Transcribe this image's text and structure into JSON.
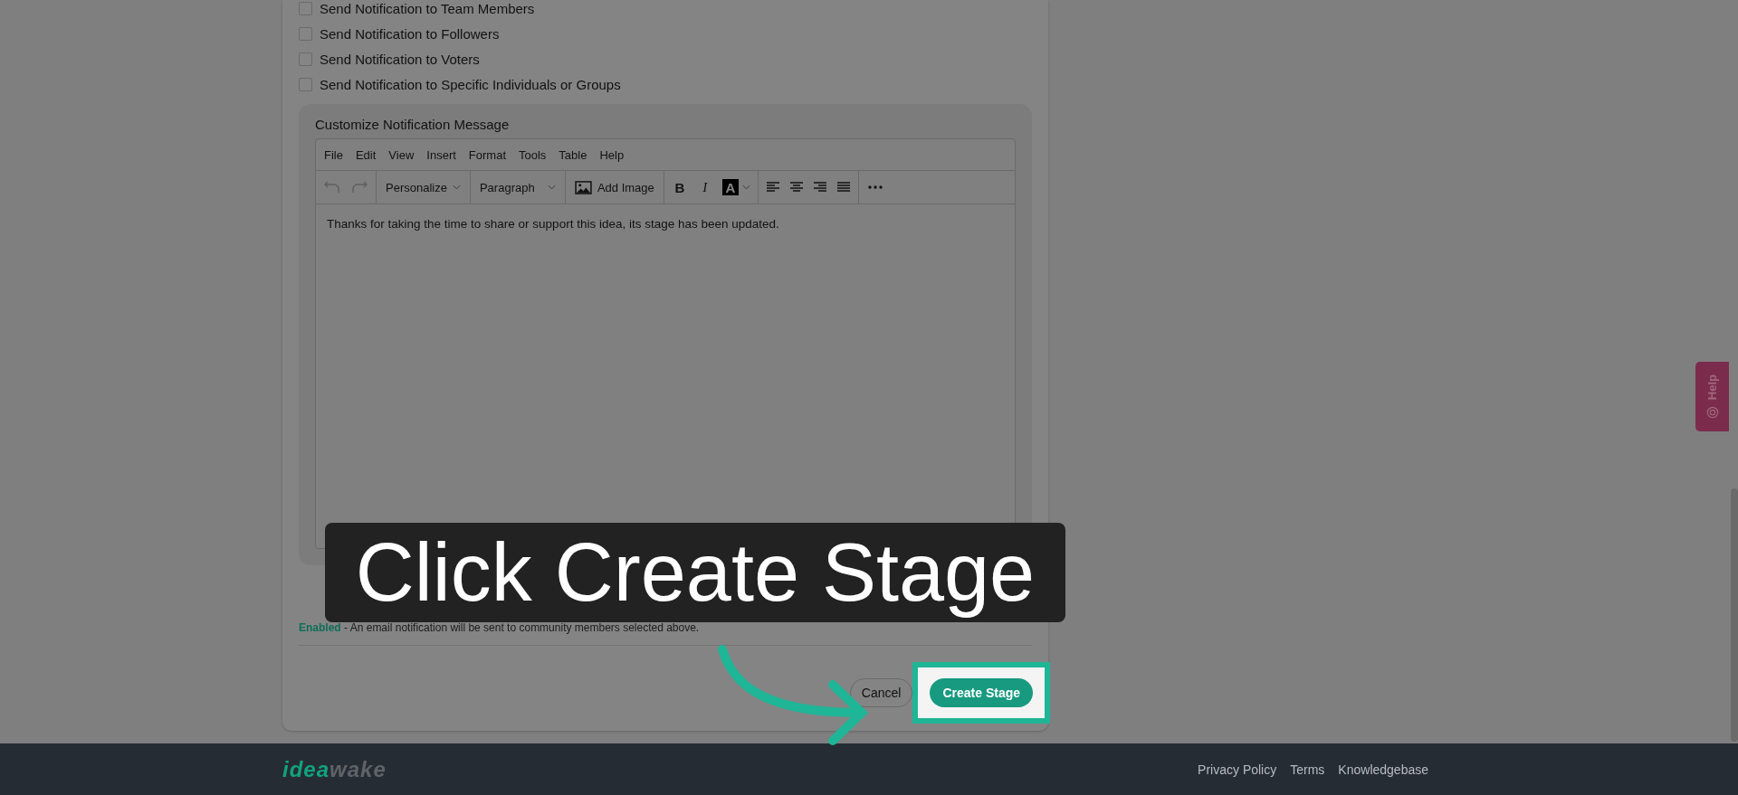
{
  "checkboxes": [
    {
      "label": "Send Notification to Team Members",
      "checked": false
    },
    {
      "label": "Send Notification to Followers",
      "checked": false
    },
    {
      "label": "Send Notification to Voters",
      "checked": false
    },
    {
      "label": "Send Notification to Specific Individuals or Groups",
      "checked": false
    }
  ],
  "message": {
    "label": "Customize Notification Message",
    "menu": [
      "File",
      "Edit",
      "View",
      "Insert",
      "Format",
      "Tools",
      "Table",
      "Help"
    ],
    "personalize": "Personalize",
    "block_format": "Paragraph",
    "add_image": "Add Image",
    "bold": "B",
    "italic": "I",
    "text_color": "A",
    "body": "Thanks for taking the time to share or support this idea, its stage has been updated."
  },
  "email_status": {
    "state": "Enabled",
    "text": " - An email notification will be sent to community members selected above."
  },
  "buttons": {
    "cancel": "Cancel",
    "create": "Create Stage"
  },
  "callout": {
    "text": "Click Create Stage"
  },
  "help_tab": {
    "label": "Help"
  },
  "footer": {
    "logo": {
      "primary": "idea",
      "secondary": "wake"
    },
    "links": [
      "Privacy Policy",
      "Terms",
      "Knowledgebase"
    ]
  }
}
